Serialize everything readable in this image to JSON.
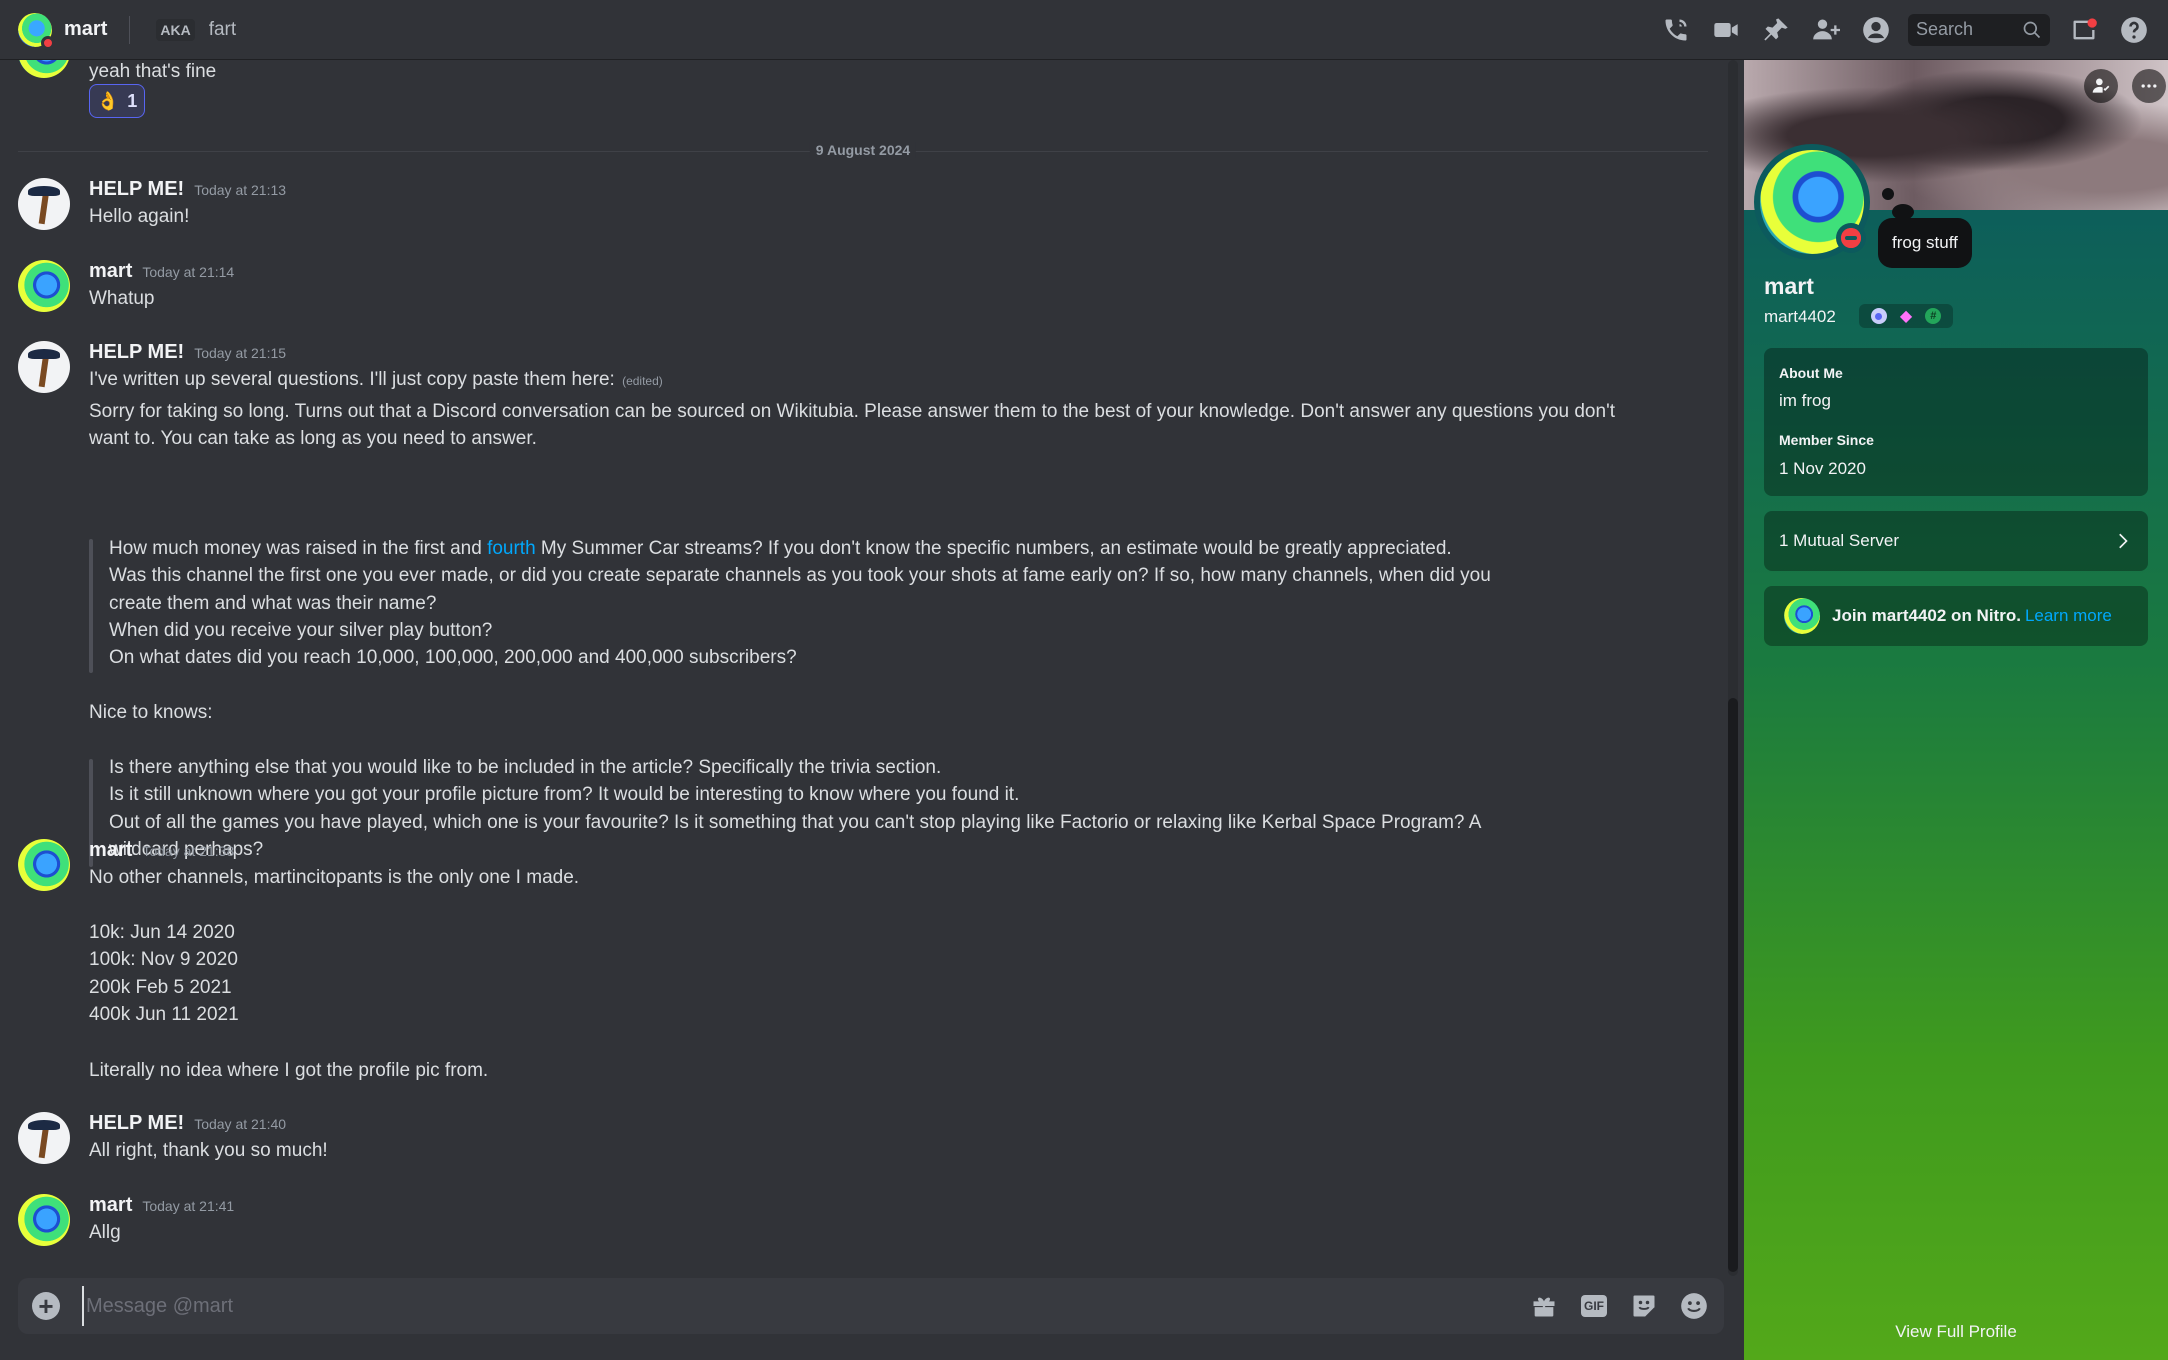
{
  "topbar": {
    "name": "mart",
    "aka_label": "AKA",
    "nickname": "fart",
    "search_placeholder": "Search",
    "icons": [
      "voice-call-icon",
      "video-call-icon",
      "pinned-messages-icon",
      "add-friends-icon",
      "user-profile-icon",
      "inbox-icon",
      "help-icon"
    ]
  },
  "messages": {
    "top_text": "yeah that's fine",
    "reaction": {
      "emoji": "👌",
      "count": "1"
    },
    "date_divider": "9 August 2024",
    "m1": {
      "author": "HELP ME!",
      "time": "Today at 21:13",
      "text": "Hello again!"
    },
    "m2": {
      "author": "mart",
      "time": "Today at 21:14",
      "text": "Whatup"
    },
    "m3": {
      "author": "HELP ME!",
      "time": "Today at 21:15",
      "line1": "I've written up several questions. I'll just copy paste them here:",
      "edited": "(edited)",
      "line2": "Sorry for taking so long. Turns out that a Discord conversation can be sourced on Wikitubia. Please answer them to the best of your knowledge. Don't answer any questions you don't",
      "line3": "want to. You can take as long as you need to answer.",
      "q1_pre": "How much money was raised in the first and ",
      "q1_link": "fourth",
      "q1_post": " My Summer Car streams? If you don't know the specific numbers, an estimate would be greatly appreciated.",
      "q2a": "Was this channel the first one you ever made, or did you create separate channels as you took your shots at fame early on? If so, how many channels, when did you",
      "q2b": "create them and what was their name?",
      "q3": "When did you receive your silver play button?",
      "q4": "On what dates did you reach 10,000, 100,000, 200,000 and 400,000 subscribers?",
      "nice": "Nice to knows:",
      "n1": "Is there anything else that you would like to be included in the article? Specifically the trivia section.",
      "n2": "Is it still unknown where you got your profile picture from? It would be interesting to know where you found it.",
      "n3a": "Out of all the games you have played, which one is your favourite? Is it something that you can't stop playing like Factorio or relaxing like Kerbal Space Program? A",
      "n3b": "wildcard perhaps?"
    },
    "m4": {
      "author": "mart",
      "time": "Today at 21:38",
      "l1": "No other channels, martincitopants is the only one I made.",
      "l2": "10k: Jun 14 2020",
      "l3": "100k: Nov 9 2020",
      "l4": "200k Feb 5 2021",
      "l5": "400k Jun 11 2021",
      "l6": "Literally no idea where I got the profile pic from."
    },
    "m5": {
      "author": "HELP ME!",
      "time": "Today at 21:40",
      "text": "All right, thank you so much!"
    },
    "m6": {
      "author": "mart",
      "time": "Today at 21:41",
      "text": "Allg"
    }
  },
  "composer": {
    "placeholder": "Message @mart",
    "gif_label": "GIF"
  },
  "profile": {
    "status": "frog stuff",
    "display_name": "mart",
    "username": "mart4402",
    "about_label": "About Me",
    "about_text": "im frog",
    "member_since_label": "Member Since",
    "member_since": "1 Nov 2020",
    "mutual_servers": "1 Mutual Server",
    "nitro_text": "Join mart4402 on Nitro.",
    "nitro_link": "Learn more",
    "view_full": "View Full Profile"
  }
}
